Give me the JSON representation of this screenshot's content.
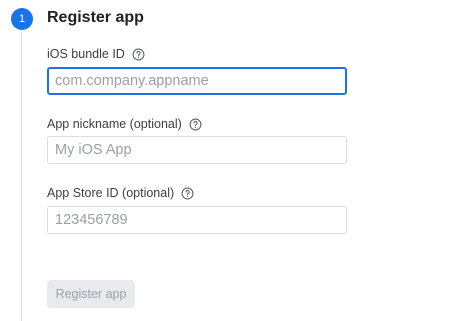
{
  "step": {
    "number": "1",
    "title": "Register app"
  },
  "fields": [
    {
      "label": "iOS bundle ID",
      "placeholder": "com.company.appname",
      "help_icon": "question-circle-icon"
    },
    {
      "label": "App nickname (optional)",
      "placeholder": "My iOS App",
      "help_icon": "question-circle-icon"
    },
    {
      "label": "App Store ID (optional)",
      "placeholder": "123456789",
      "help_icon": "question-circle-icon"
    }
  ],
  "actions": {
    "register_label": "Register app"
  },
  "colors": {
    "accent": "#1a73e8",
    "disabled_button_bg": "#e8eaed",
    "disabled_button_text": "#9aa0a6"
  }
}
